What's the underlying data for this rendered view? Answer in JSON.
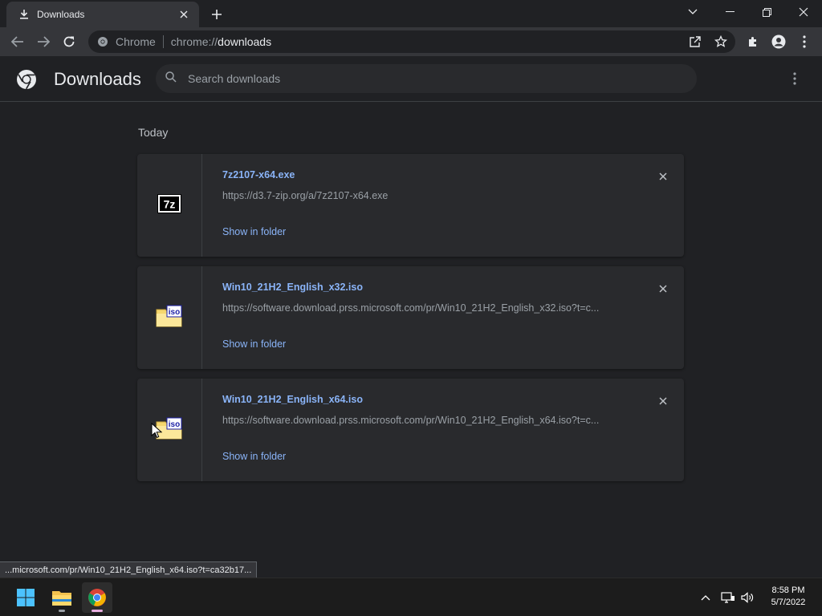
{
  "browser": {
    "tab": {
      "title": "Downloads"
    },
    "window_controls": {
      "tab_search": "tab-search",
      "minimize": "minimize",
      "restore": "restore",
      "close": "close"
    },
    "omnibox": {
      "scheme_label": "Chrome",
      "url_prefix": "chrome://",
      "url_host": "downloads"
    }
  },
  "page": {
    "title": "Downloads",
    "search_placeholder": "Search downloads",
    "section_label": "Today",
    "downloads": [
      {
        "file_name": "7z2107-x64.exe",
        "url": "https://d3.7-zip.org/a/7z2107-x64.exe",
        "action": "Show in folder",
        "icon": "7z-icon"
      },
      {
        "file_name": "Win10_21H2_English_x32.iso",
        "url": "https://software.download.prss.microsoft.com/pr/Win10_21H2_English_x32.iso?t=c...",
        "action": "Show in folder",
        "icon": "iso-file-icon"
      },
      {
        "file_name": "Win10_21H2_English_x64.iso",
        "url": "https://software.download.prss.microsoft.com/pr/Win10_21H2_English_x64.iso?t=c...",
        "action": "Show in folder",
        "icon": "iso-file-icon"
      }
    ]
  },
  "status_bubble": {
    "text": "...microsoft.com/pr/Win10_21H2_English_x64.iso?t=ca32b17..."
  },
  "taskbar": {
    "clock_time": "8:58 PM",
    "clock_date": "5/7/2022"
  },
  "colors": {
    "accent_link": "#8ab4f8",
    "background": "#202124",
    "card": "#292a2d"
  }
}
